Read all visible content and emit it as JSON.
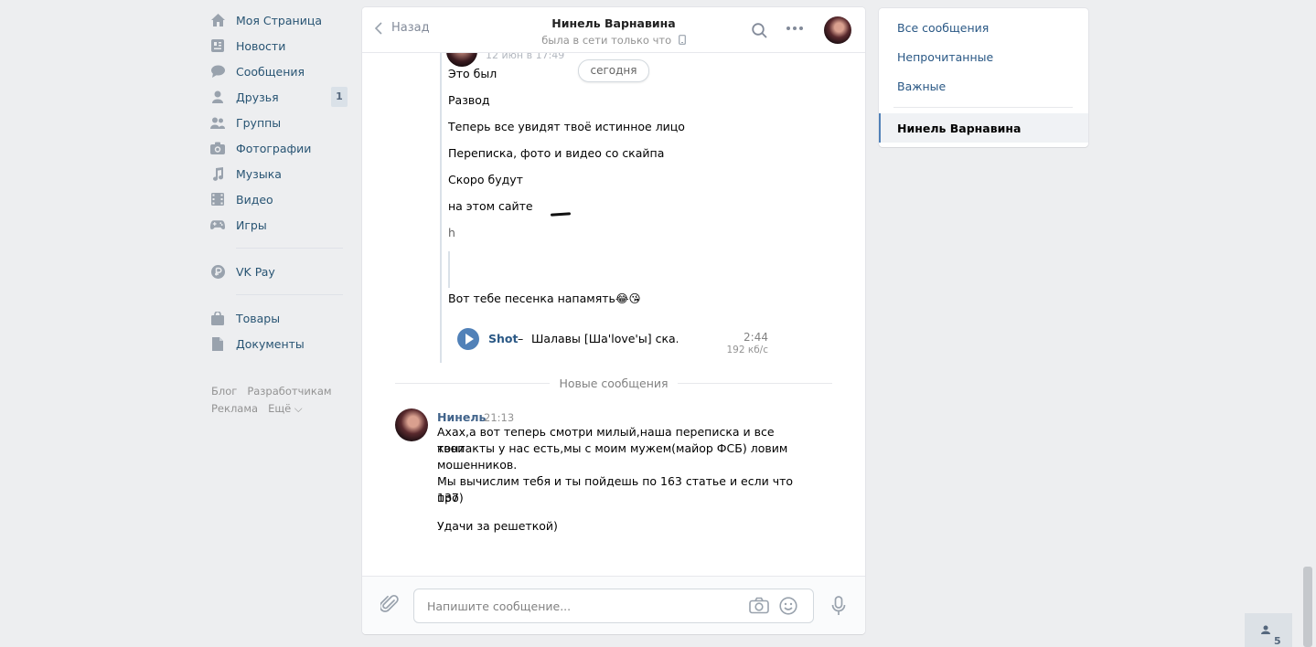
{
  "left_nav": {
    "items": [
      {
        "label": "Моя Страница",
        "icon": "home-icon"
      },
      {
        "label": "Новости",
        "icon": "news-icon"
      },
      {
        "label": "Сообщения",
        "icon": "chat-icon"
      },
      {
        "label": "Друзья",
        "icon": "friends-icon",
        "badge": "1"
      },
      {
        "label": "Группы",
        "icon": "groups-icon"
      },
      {
        "label": "Фотографии",
        "icon": "camera-icon"
      },
      {
        "label": "Музыка",
        "icon": "music-icon"
      },
      {
        "label": "Видео",
        "icon": "video-icon"
      },
      {
        "label": "Игры",
        "icon": "games-icon"
      }
    ],
    "vkpay": {
      "label": "VK Pay",
      "icon": "vkpay-icon"
    },
    "extra": [
      {
        "label": "Товары",
        "icon": "bag-icon"
      },
      {
        "label": "Документы",
        "icon": "document-icon"
      }
    ],
    "footer": {
      "blog": "Блог",
      "dev": "Разработчикам",
      "ads": "Реклама",
      "more": "Ещё ⌵"
    }
  },
  "chat": {
    "back_label": "Назад",
    "peer_name": "Нинель Варнавина",
    "peer_status": "была в сети только что",
    "forwarded": {
      "date": "12 июн в 17:49",
      "today_label": "сегодня",
      "lines": [
        "Это был",
        "Развод",
        "Теперь все увидят твоё истинное лицо",
        "Переписка, фото и видео со скайпа",
        "Скоро будут",
        "на этом сайте",
        "h",
        "Вот тебе песенка напамять😂😘"
      ],
      "audio": {
        "artist": "Shot",
        "dash": "–",
        "title": "Шалавы [Ша'love'ы] ска...",
        "duration": "2:44",
        "bitrate": "192 кб/с"
      }
    },
    "new_messages_label": "Новые сообщения",
    "message": {
      "author": "Нинель",
      "time": "21:13",
      "lines": [
        "Ахах,а вот теперь смотри милый,наша переписка и все твои",
        "контакты у нас есть,мы с моим мужем(майор ФСБ) ловим",
        "мошенников.",
        "Мы вычислим тебя и ты пойдешь по 163 статье и если что про",
        "137)",
        "Удачи за решеткой)"
      ]
    },
    "composer": {
      "placeholder": "Напишите сообщение..."
    }
  },
  "right_menu": {
    "items": [
      "Все сообщения",
      "Непрочитанные",
      "Важные"
    ],
    "active": "Нинель Варнавина"
  },
  "online_count": "5"
}
